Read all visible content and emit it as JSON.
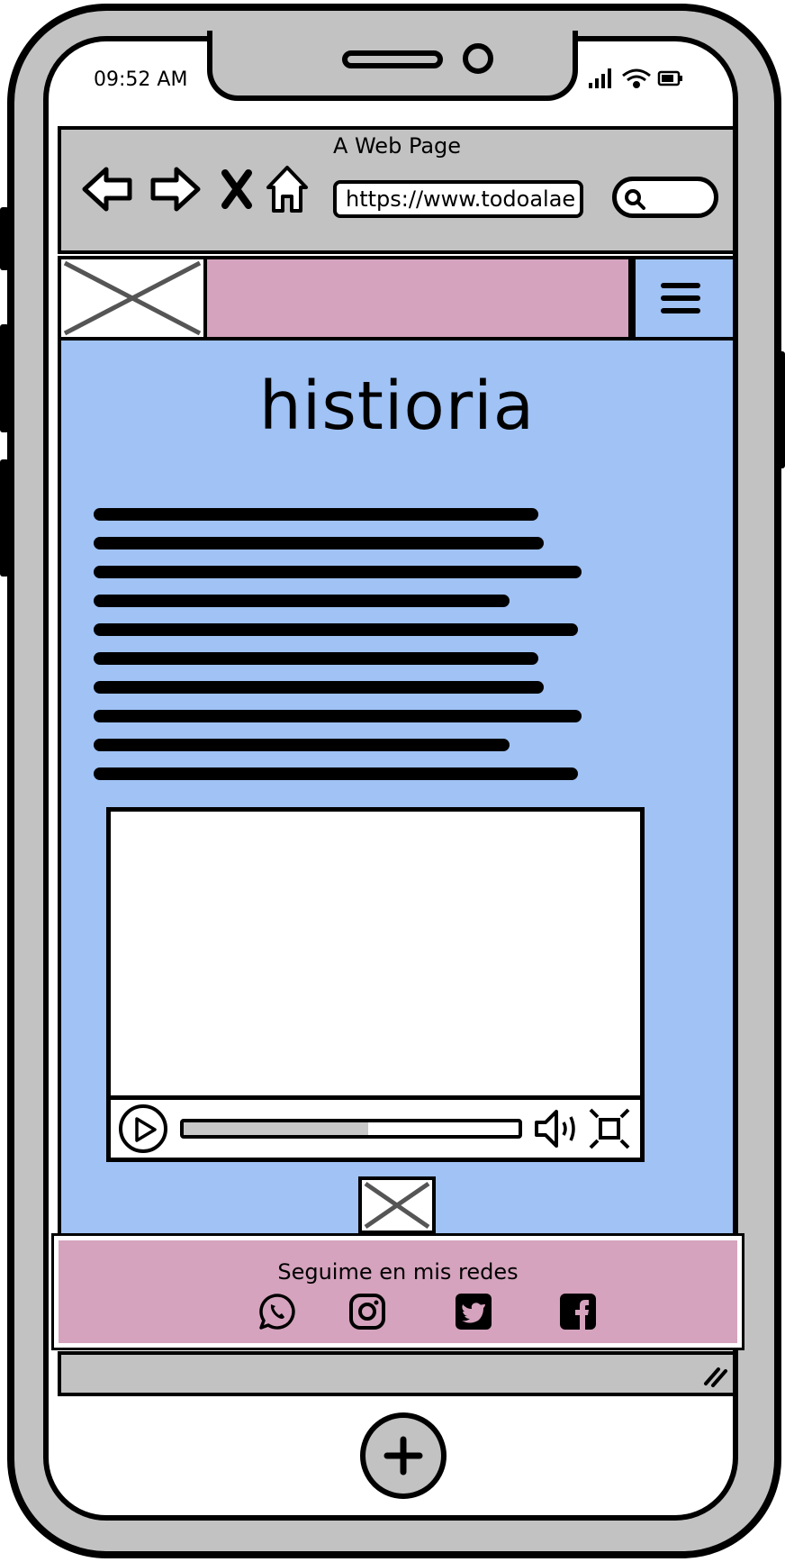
{
  "status_bar": {
    "time": "09:52 AM",
    "icons": [
      "signal-icon",
      "wifi-icon",
      "battery-icon"
    ]
  },
  "browser": {
    "page_title": "A Web Page",
    "url": "https://www.todoalae",
    "nav_icons": [
      "back-arrow-icon",
      "forward-arrow-icon",
      "close-icon",
      "home-icon"
    ],
    "search_icon": "search-icon"
  },
  "site_header": {
    "logo_icon": "image-placeholder-icon",
    "menu_icon": "hamburger-menu-icon"
  },
  "main": {
    "heading": "histioria",
    "body_text_placeholder_lines": 10
  },
  "video_player": {
    "progress": 0.55,
    "icons": [
      "play-icon",
      "volume-icon",
      "fullscreen-icon"
    ]
  },
  "footer": {
    "label": "Seguime en mis redes",
    "social_icons": [
      "whatsapp-icon",
      "instagram-icon",
      "twitter-icon",
      "facebook-icon"
    ]
  },
  "device": {
    "home_button_icon": "plus-icon"
  },
  "colors": {
    "header_band": "#d5a3bd",
    "content_bg": "#a0c2f5",
    "shell": "#c2c2c2"
  }
}
